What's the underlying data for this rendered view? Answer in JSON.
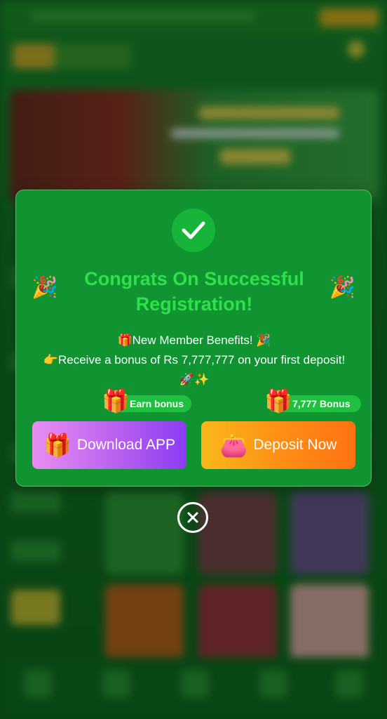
{
  "modal": {
    "title": "Congrats On Successful Registration!",
    "benefits_line1": "🎁New Member Benefits! 🎉",
    "benefits_line2": "👉Receive a bonus of Rs 7,777,777 on your first deposit!",
    "benefits_line3": "🚀✨",
    "left_badge": "Earn bonus",
    "right_badge": "7,777 Bonus",
    "download_label": "Download APP",
    "deposit_label": "Deposit Now"
  },
  "icons": {
    "success": "check-circle-icon",
    "popper": "party-popper-icon",
    "gift": "gift-icon",
    "wallet": "wallet-icon",
    "close": "close-circle-icon"
  },
  "colors": {
    "modal_bg": "#109432",
    "title": "#2ee04a",
    "download_gradient": "#b35cf0",
    "deposit_gradient": "#ff8c16"
  }
}
